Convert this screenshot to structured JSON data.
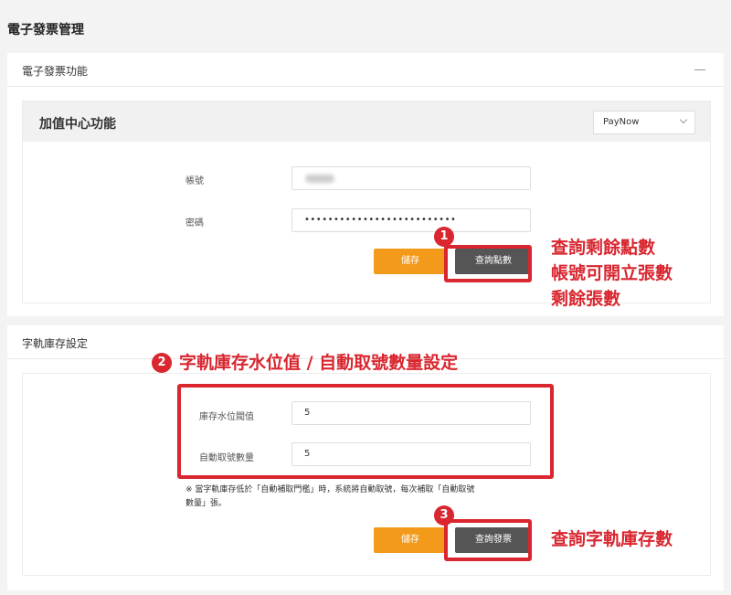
{
  "page": {
    "title": "電子發票管理"
  },
  "invoice_card": {
    "title": "電子發票功能",
    "section": {
      "title": "加值中心功能",
      "provider_select": {
        "value": "PayNow"
      },
      "account": {
        "label": "帳號",
        "value": ""
      },
      "password": {
        "label": "密碼",
        "value": "••••••••••••••••••••••••••"
      },
      "save_label": "儲存",
      "query_points_label": "查詢點數"
    }
  },
  "stock_card": {
    "title": "字軌庫存設定",
    "threshold": {
      "label": "庫存水位閥值",
      "value": "5"
    },
    "auto_fetch": {
      "label": "自動取號數量",
      "value": "5"
    },
    "note_line1": "※ 當字軌庫存低於「自動補取門檻」時，系統將自動取號，每次補取「自動取號",
    "note_line2": "數量」張。",
    "save_label": "儲存",
    "query_invoice_label": "查詢發票"
  },
  "annotations": {
    "badge1": "1",
    "badge2": "2",
    "badge3": "3",
    "text1_line1": "查詢剩餘點數",
    "text1_line2": "帳號可開立張數",
    "text1_line3": "剩餘張數",
    "text2": "字軌庫存水位值 / 自動取號數量設定",
    "text3": "查詢字軌庫存數",
    "color": "#d9262f"
  }
}
